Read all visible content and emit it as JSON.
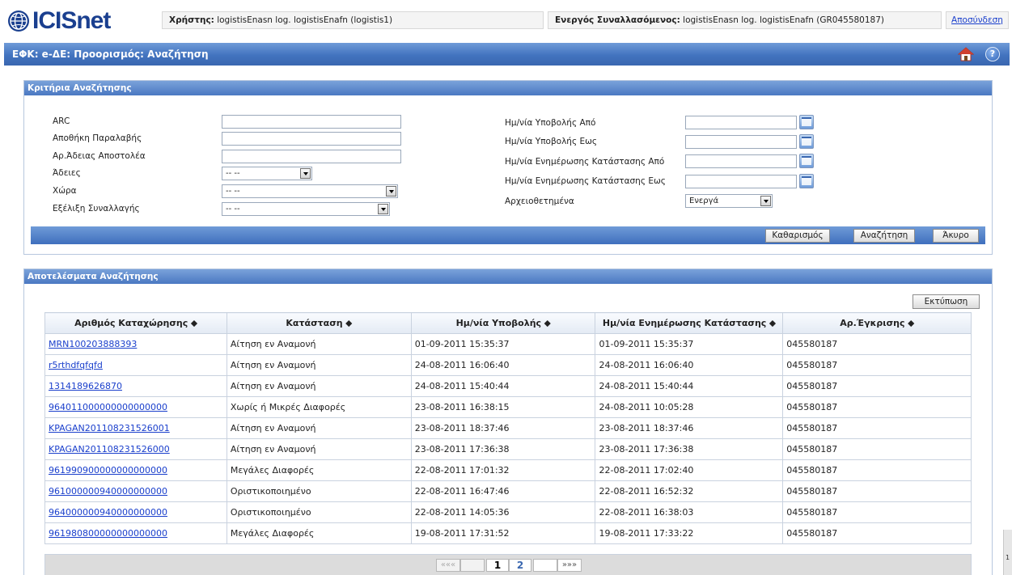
{
  "app": {
    "logo_text": "ICISnet",
    "user_label": "Χρήστης:",
    "user_value": "logistisEnasn log. logistisEnafn (logistis1)",
    "trader_label": "Ενεργός Συναλλασόμενος:",
    "trader_value": "logistisEnasn log. logistisEnafn (GR045580187)",
    "logout": "Αποσύνδεση",
    "page_title": "ΕΦΚ: e-ΔΕ: Προορισμός: Αναζήτηση",
    "help_symbol": "?"
  },
  "criteria": {
    "heading": "Κριτήρια Αναζήτησης",
    "left_fields": {
      "arc": "ARC",
      "warehouse": "Αποθήκη Παραλαβής",
      "sender_license": "Αρ.Άδειας Αποστολέα",
      "licenses": "Άδειες",
      "country": "Χώρα",
      "progress": "Εξέλιξη Συναλλαγής"
    },
    "select_default": "-- --",
    "right_fields": {
      "submit_from": "Ημ/νία Υποβολής Από",
      "submit_to": "Ημ/νία Υποβολής Εως",
      "status_from": "Ημ/νία Ενημέρωσης Κατάστασης Από",
      "status_to": "Ημ/νία Ενημέρωσης Κατάστασης Εως",
      "archived": "Αρχειοθετημένα"
    },
    "archived_value": "Ενεργά",
    "buttons": {
      "clear": "Καθαρισμός",
      "search": "Αναζήτηση",
      "cancel": "Άκυρο"
    }
  },
  "results": {
    "heading": "Αποτελέσματα Αναζήτησης",
    "print": "Εκτύπωση",
    "columns": {
      "c0": "Αριθμός Καταχώρησης ⬥",
      "c1": "Κατάσταση ⬥",
      "c2": "Ημ/νία Υποβολής ⬥",
      "c3": "Ημ/νία Ενημέρωσης Κατάστασης ⬥",
      "c4": "Αρ.Έγκρισης ⬥"
    },
    "rows": {
      "r0": {
        "id": "MRN100203888393",
        "status": "Αίτηση εν Αναμονή",
        "submitted": "01-09-2011 15:35:37",
        "updated": "01-09-2011 15:35:37",
        "approval": "045580187"
      },
      "r1": {
        "id": "r5rthdfqfqfd",
        "status": "Αίτηση εν Αναμονή",
        "submitted": "24-08-2011 16:06:40",
        "updated": "24-08-2011 16:06:40",
        "approval": "045580187"
      },
      "r2": {
        "id": "1314189626870",
        "status": "Αίτηση εν Αναμονή",
        "submitted": "24-08-2011 15:40:44",
        "updated": "24-08-2011 15:40:44",
        "approval": "045580187"
      },
      "r3": {
        "id": "964011000000000000000",
        "status": "Χωρίς ή Μικρές Διαφορές",
        "submitted": "23-08-2011 16:38:15",
        "updated": "24-08-2011 10:05:28",
        "approval": "045580187"
      },
      "r4": {
        "id": "KPAGAN201108231526001",
        "status": "Αίτηση εν Αναμονή",
        "submitted": "23-08-2011 18:37:46",
        "updated": "23-08-2011 18:37:46",
        "approval": "045580187"
      },
      "r5": {
        "id": "KPAGAN201108231526000",
        "status": "Αίτηση εν Αναμονή",
        "submitted": "23-08-2011 17:36:38",
        "updated": "23-08-2011 17:36:38",
        "approval": "045580187"
      },
      "r6": {
        "id": "961990900000000000000",
        "status": "Μεγάλες Διαφορές",
        "submitted": "22-08-2011 17:01:32",
        "updated": "22-08-2011 17:02:40",
        "approval": "045580187"
      },
      "r7": {
        "id": "961000000940000000000",
        "status": "Οριστικοποιημένο",
        "submitted": "22-08-2011 16:47:46",
        "updated": "22-08-2011 16:52:32",
        "approval": "045580187"
      },
      "r8": {
        "id": "964000000940000000000",
        "status": "Οριστικοποιημένο",
        "submitted": "22-08-2011 14:05:36",
        "updated": "22-08-2011 16:38:03",
        "approval": "045580187"
      },
      "r9": {
        "id": "961980800000000000000",
        "status": "Μεγάλες Διαφορές",
        "submitted": "19-08-2011 17:31:52",
        "updated": "19-08-2011 17:33:22",
        "approval": "045580187"
      }
    },
    "pager": {
      "first": "«««",
      "page1": "1",
      "page2": "2",
      "last": "»»»"
    }
  },
  "scroll_stub_text": "1"
}
